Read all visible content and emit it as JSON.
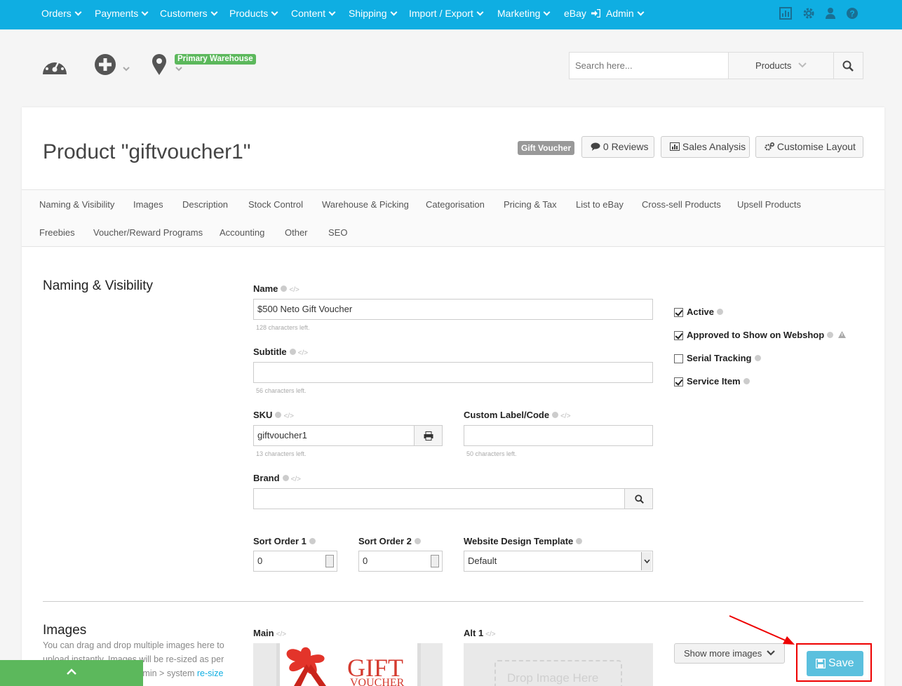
{
  "topnav": {
    "items": [
      "Orders",
      "Payments",
      "Customers",
      "Products",
      "Content",
      "Shipping",
      "Import / Export",
      "Marketing",
      "eBay",
      "Admin"
    ],
    "icons": [
      "chart-icon",
      "gear-icon",
      "user-icon",
      "help-icon"
    ],
    "color": "#0faee2"
  },
  "toolbar": {
    "warehouse_badge": "Primary Warehouse",
    "badge_color": "#5cb85c"
  },
  "search": {
    "placeholder": "Search here...",
    "scope": "Products"
  },
  "header": {
    "title": "Product \"giftvoucher1\"",
    "badge": "Gift Voucher",
    "reviews_label": "0 Reviews",
    "sales_label": "Sales Analysis",
    "customise_label": "Customise Layout"
  },
  "tabs": [
    "Naming & Visibility",
    "Images",
    "Description",
    "Stock Control",
    "Warehouse & Picking",
    "Categorisation",
    "Pricing & Tax",
    "List to eBay",
    "Cross-sell Products",
    "Upsell Products",
    "Freebies",
    "Voucher/Reward Programs",
    "Accounting",
    "Other",
    "SEO"
  ],
  "naming": {
    "section_title": "Naming & Visibility",
    "name_label": "Name",
    "name_value": "$500 Neto Gift Voucher",
    "name_hint": "128 characters left.",
    "subtitle_label": "Subtitle",
    "subtitle_value": "",
    "subtitle_hint": "56 characters left.",
    "sku_label": "SKU",
    "sku_value": "giftvoucher1",
    "sku_hint": "13 characters left.",
    "custom_label": "Custom Label/Code",
    "custom_value": "",
    "custom_hint": "50 characters left.",
    "brand_label": "Brand",
    "brand_value": "",
    "sort1_label": "Sort Order 1",
    "sort1_value": "0",
    "sort2_label": "Sort Order 2",
    "sort2_value": "0",
    "template_label": "Website Design Template",
    "template_value": "Default"
  },
  "checkboxes": [
    {
      "label": "Active",
      "checked": true
    },
    {
      "label": "Approved to Show on Webshop",
      "checked": true
    },
    {
      "label": "Serial Tracking",
      "checked": false
    },
    {
      "label": "Service Item",
      "checked": true
    }
  ],
  "images": {
    "section_title": "Images",
    "desc": "You can drag and drop multiple images here to upload instantly. Images will be re-sized as per your re-size settings in admin > system",
    "desc_link": "re-size settings",
    "main_label": "Main",
    "alt_label": "Alt 1",
    "gift_text_1": "GIFT",
    "gift_text_2": "VOUCHER",
    "drop_text": "Drop Image Here",
    "more_label": "Show more images"
  },
  "save_label": "Save"
}
